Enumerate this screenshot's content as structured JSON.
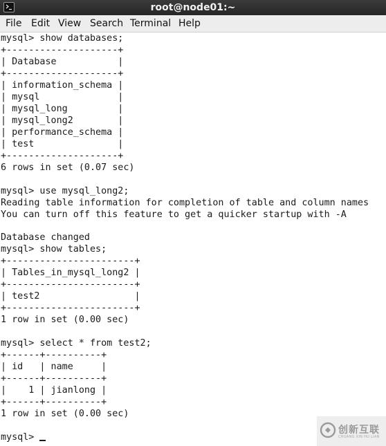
{
  "window": {
    "title": "root@node01:~"
  },
  "menubar": {
    "items": [
      "File",
      "Edit",
      "View",
      "Search",
      "Terminal",
      "Help"
    ]
  },
  "terminal": {
    "lines": [
      "mysql> show databases;",
      "+--------------------+",
      "| Database           |",
      "+--------------------+",
      "| information_schema |",
      "| mysql              |",
      "| mysql_long         |",
      "| mysql_long2        |",
      "| performance_schema |",
      "| test               |",
      "+--------------------+",
      "6 rows in set (0.07 sec)",
      "",
      "mysql> use mysql_long2;",
      "Reading table information for completion of table and column names",
      "You can turn off this feature to get a quicker startup with -A",
      "",
      "Database changed",
      "mysql> show tables;",
      "+-----------------------+",
      "| Tables_in_mysql_long2 |",
      "+-----------------------+",
      "| test2                 |",
      "+-----------------------+",
      "1 row in set (0.00 sec)",
      "",
      "mysql> select * from test2;",
      "+------+----------+",
      "| id   | name     |",
      "+------+----------+",
      "|    1 | jianlong |",
      "+------+----------+",
      "1 row in set (0.00 sec)",
      "",
      "mysql> "
    ]
  },
  "watermark": {
    "text": "创新互联",
    "subtext": "CHUANG XIN HU LIAN"
  },
  "icons": {
    "app": "terminal-icon",
    "watermark_logo": "chuangxin-logo-icon"
  }
}
